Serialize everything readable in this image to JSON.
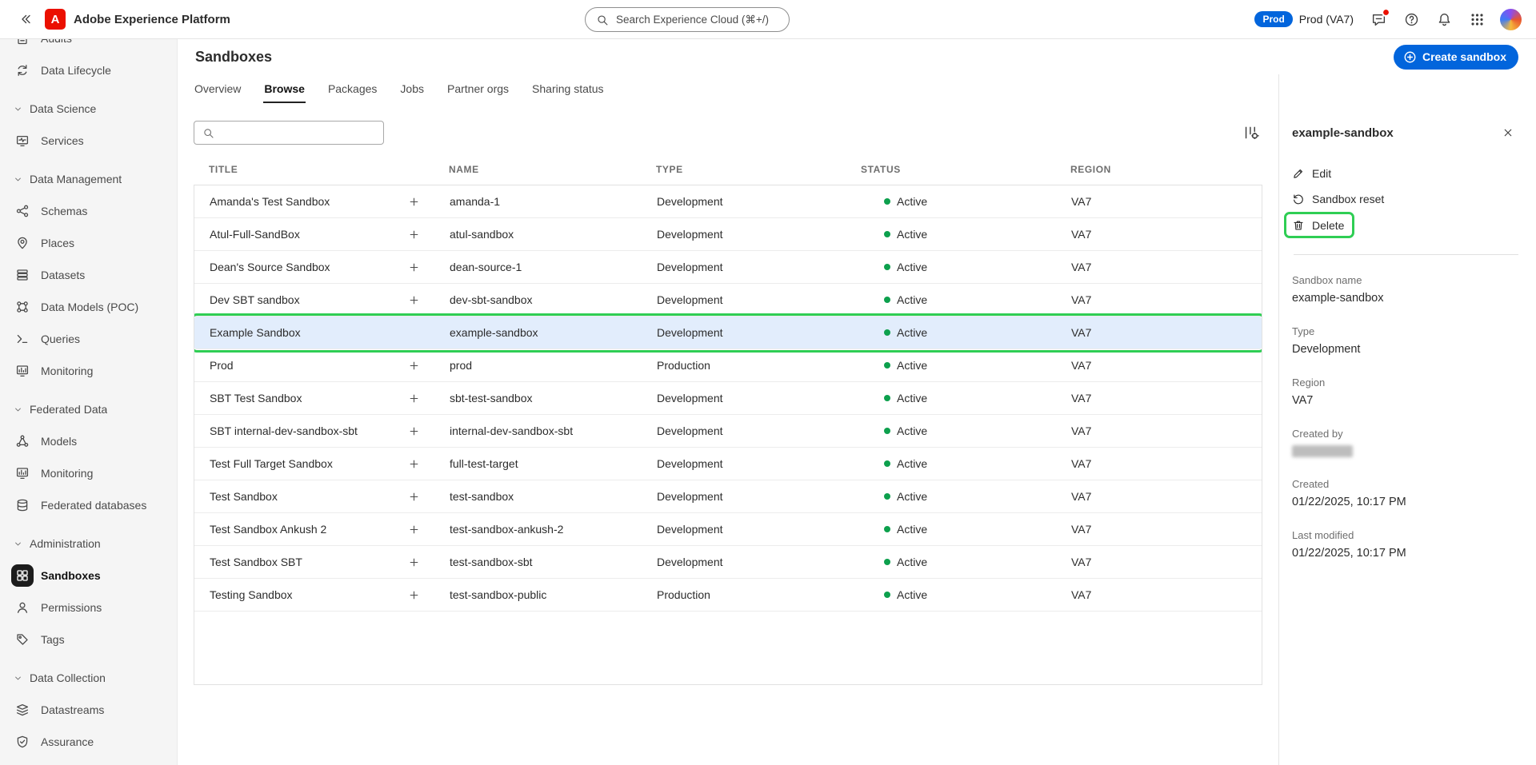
{
  "colors": {
    "accent_blue": "#0265DC",
    "status_green": "#0DA04D",
    "annotation_green": "#2FCE54",
    "adobe_red": "#EB1000"
  },
  "topbar": {
    "logo_letter": "A",
    "app_title": "Adobe Experience Platform",
    "search_placeholder": "Search Experience Cloud (⌘+/)",
    "env_badge": "Prod",
    "env_name": "Prod (VA7)"
  },
  "sidebar": {
    "items": [
      {
        "type": "item",
        "label": "Audits",
        "icon": "audits-icon"
      },
      {
        "type": "item",
        "label": "Data Lifecycle",
        "icon": "data-lifecycle-icon"
      },
      {
        "type": "section",
        "label": "Data Science"
      },
      {
        "type": "item",
        "label": "Services",
        "icon": "services-icon"
      },
      {
        "type": "section",
        "label": "Data Management"
      },
      {
        "type": "item",
        "label": "Schemas",
        "icon": "schemas-icon"
      },
      {
        "type": "item",
        "label": "Places",
        "icon": "places-icon"
      },
      {
        "type": "item",
        "label": "Datasets",
        "icon": "datasets-icon"
      },
      {
        "type": "item",
        "label": "Data Models (POC)",
        "icon": "data-models-icon"
      },
      {
        "type": "item",
        "label": "Queries",
        "icon": "queries-icon"
      },
      {
        "type": "item",
        "label": "Monitoring",
        "icon": "monitoring-icon"
      },
      {
        "type": "section",
        "label": "Federated Data"
      },
      {
        "type": "item",
        "label": "Models",
        "icon": "models-icon"
      },
      {
        "type": "item",
        "label": "Monitoring",
        "icon": "monitoring-icon"
      },
      {
        "type": "item",
        "label": "Federated databases",
        "icon": "federated-databases-icon"
      },
      {
        "type": "section",
        "label": "Administration"
      },
      {
        "type": "item",
        "label": "Sandboxes",
        "icon": "sandboxes-icon",
        "active": true
      },
      {
        "type": "item",
        "label": "Permissions",
        "icon": "permissions-icon"
      },
      {
        "type": "item",
        "label": "Tags",
        "icon": "tags-icon"
      },
      {
        "type": "section",
        "label": "Data Collection"
      },
      {
        "type": "item",
        "label": "Datastreams",
        "icon": "datastreams-icon"
      },
      {
        "type": "item",
        "label": "Assurance",
        "icon": "assurance-icon"
      }
    ]
  },
  "header": {
    "title": "Sandboxes",
    "create_button": "Create sandbox"
  },
  "tabs": [
    {
      "label": "Overview"
    },
    {
      "label": "Browse",
      "active": true
    },
    {
      "label": "Packages"
    },
    {
      "label": "Jobs"
    },
    {
      "label": "Partner orgs"
    },
    {
      "label": "Sharing status"
    }
  ],
  "table": {
    "columns": [
      "TITLE",
      "NAME",
      "TYPE",
      "STATUS",
      "REGION"
    ],
    "rows": [
      {
        "title": "Amanda's Test Sandbox",
        "name": "amanda-1",
        "type": "Development",
        "status": "Active",
        "region": "VA7"
      },
      {
        "title": "Atul-Full-SandBox",
        "name": "atul-sandbox",
        "type": "Development",
        "status": "Active",
        "region": "VA7"
      },
      {
        "title": "Dean's Source Sandbox",
        "name": "dean-source-1",
        "type": "Development",
        "status": "Active",
        "region": "VA7"
      },
      {
        "title": "Dev SBT sandbox",
        "name": "dev-sbt-sandbox",
        "type": "Development",
        "status": "Active",
        "region": "VA7"
      },
      {
        "title": "Example Sandbox",
        "name": "example-sandbox",
        "type": "Development",
        "status": "Active",
        "region": "VA7",
        "selected": true
      },
      {
        "title": "Prod",
        "name": "prod",
        "type": "Production",
        "status": "Active",
        "region": "VA7"
      },
      {
        "title": "SBT Test Sandbox",
        "name": "sbt-test-sandbox",
        "type": "Development",
        "status": "Active",
        "region": "VA7"
      },
      {
        "title": "SBT internal-dev-sandbox-sbt",
        "name": "internal-dev-sandbox-sbt",
        "type": "Development",
        "status": "Active",
        "region": "VA7"
      },
      {
        "title": "Test Full Target Sandbox",
        "name": "full-test-target",
        "type": "Development",
        "status": "Active",
        "region": "VA7"
      },
      {
        "title": "Test Sandbox",
        "name": "test-sandbox",
        "type": "Development",
        "status": "Active",
        "region": "VA7"
      },
      {
        "title": "Test Sandbox Ankush 2",
        "name": "test-sandbox-ankush-2",
        "type": "Development",
        "status": "Active",
        "region": "VA7"
      },
      {
        "title": "Test Sandbox SBT",
        "name": "test-sandbox-sbt",
        "type": "Development",
        "status": "Active",
        "region": "VA7"
      },
      {
        "title": "Testing Sandbox",
        "name": "test-sandbox-public",
        "type": "Production",
        "status": "Active",
        "region": "VA7"
      }
    ]
  },
  "detail_panel": {
    "title": "example-sandbox",
    "actions": [
      {
        "label": "Edit",
        "icon": "edit-icon"
      },
      {
        "label": "Sandbox reset",
        "icon": "reset-icon"
      },
      {
        "label": "Delete",
        "icon": "trash-icon",
        "annotated": true
      }
    ],
    "fields": [
      {
        "label": "Sandbox name",
        "value": "example-sandbox"
      },
      {
        "label": "Type",
        "value": "Development"
      },
      {
        "label": "Region",
        "value": "VA7"
      },
      {
        "label": "Created by",
        "value": "",
        "redacted": true
      },
      {
        "label": "Created",
        "value": "01/22/2025, 10:17 PM"
      },
      {
        "label": "Last modified",
        "value": "01/22/2025, 10:17 PM"
      }
    ]
  }
}
